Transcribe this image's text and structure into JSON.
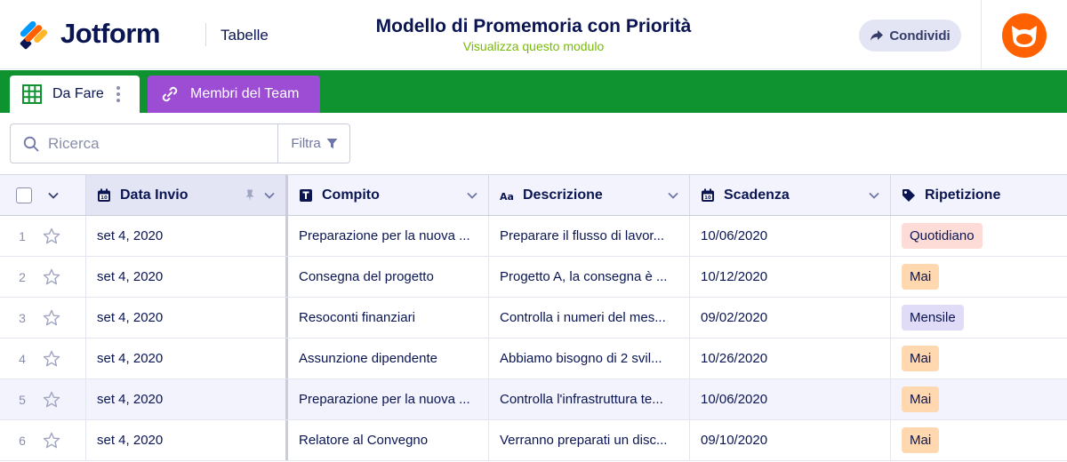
{
  "header": {
    "logo_text": "Jotform",
    "section": "Tabelle",
    "form_title": "Modello di Promemoria con Priorità",
    "form_subtitle": "Visualizza questo modulo",
    "share_label": "Condividi"
  },
  "tabs": {
    "active_label": "Da Fare",
    "team_label": "Membri del Team"
  },
  "search": {
    "placeholder": "Ricerca",
    "filter_label": "Filtra"
  },
  "table": {
    "columns": [
      "Data Invio",
      "Compito",
      "Descrizione",
      "Scadenza",
      "Ripetizione"
    ],
    "rows": [
      {
        "num": "1",
        "date": "set 4, 2020",
        "task": "Preparazione per la nuova ...",
        "desc": "Preparare il flusso di lavor...",
        "due": "10/06/2020",
        "repeat": "Quotidiano",
        "kind": "daily"
      },
      {
        "num": "2",
        "date": "set 4, 2020",
        "task": "Consegna del progetto",
        "desc": "Progetto A, la consegna è ...",
        "due": "10/12/2020",
        "repeat": "Mai",
        "kind": "never"
      },
      {
        "num": "3",
        "date": "set 4, 2020",
        "task": "Resoconti finanziari",
        "desc": "Controlla i numeri del mes...",
        "due": "09/02/2020",
        "repeat": "Mensile",
        "kind": "monthly"
      },
      {
        "num": "4",
        "date": "set 4, 2020",
        "task": "Assunzione dipendente",
        "desc": "Abbiamo bisogno di 2 svil...",
        "due": "10/26/2020",
        "repeat": "Mai",
        "kind": "never"
      },
      {
        "num": "5",
        "date": "set 4, 2020",
        "task": "Preparazione per la nuova ...",
        "desc": "Controlla l'infrastruttura te...",
        "due": "10/06/2020",
        "repeat": "Mai",
        "kind": "never"
      },
      {
        "num": "6",
        "date": "set 4, 2020",
        "task": "Relatore al Convegno",
        "desc": "Verranno preparati un disc...",
        "due": "09/10/2020",
        "repeat": "Mai",
        "kind": "never"
      }
    ]
  },
  "colors": {
    "brand_navy": "#0a1551",
    "tab_bar_green": "#0f9230",
    "team_tab_purple": "#9c4dd3",
    "avatar_orange": "#ff6100",
    "subtitle_green": "#78bb07"
  }
}
